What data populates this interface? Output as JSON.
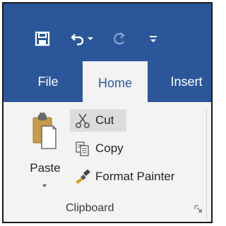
{
  "quick_access": {
    "save_icon": "save-icon",
    "undo_icon": "undo-icon",
    "undo_dropdown_icon": "chevron-down-icon",
    "redo_icon": "redo-icon",
    "customize_icon": "customize-qat-icon"
  },
  "tabs": [
    {
      "label": "File",
      "active": false
    },
    {
      "label": "Home",
      "active": true
    },
    {
      "label": "Insert",
      "active": false
    }
  ],
  "clipboard": {
    "paste_label": "Paste",
    "cut_label": "Cut",
    "copy_label": "Copy",
    "format_painter_label": "Format Painter",
    "group_label": "Clipboard"
  },
  "colors": {
    "title_bar": "#2b579a",
    "ribbon_bg": "#f3f3f3",
    "hover_bg": "#dcdcdc"
  }
}
